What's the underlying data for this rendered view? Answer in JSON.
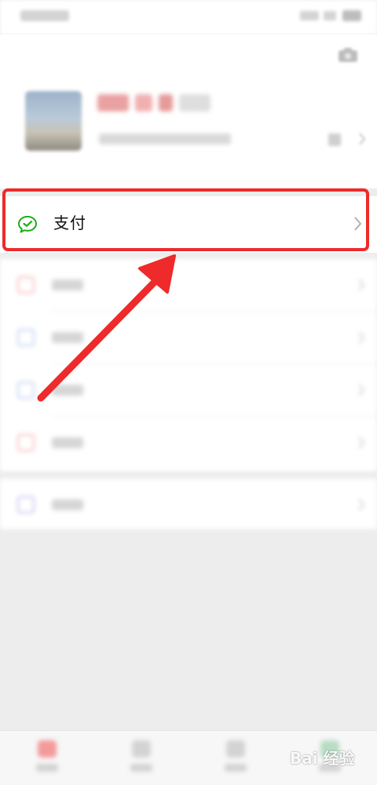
{
  "pay": {
    "label": "支付",
    "icon": "wechat-pay-icon",
    "accent": "#1aad19"
  },
  "annotation": {
    "color": "#ee2a2a"
  },
  "menu": {
    "group1_icon_colors": [
      "#f07f7f",
      "#8aa6e6",
      "#8aa6e6",
      "#f07f7f"
    ],
    "group2_icon_colors": [
      "#9a8be0"
    ]
  },
  "watermark": {
    "text": "Bai 经验",
    "logo": "baidu-paw-icon"
  }
}
